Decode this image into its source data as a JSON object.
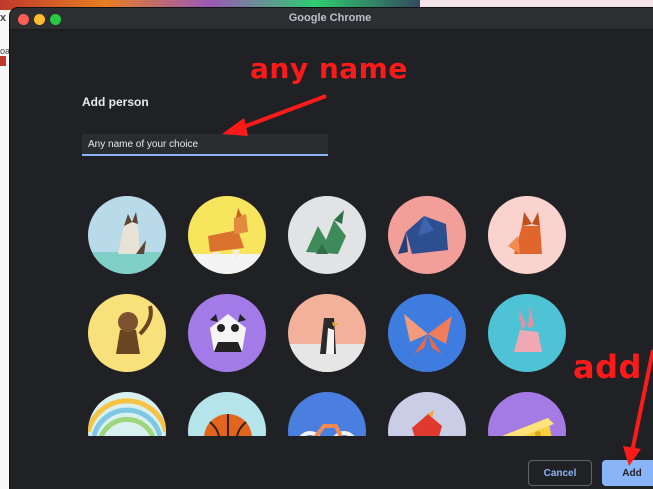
{
  "window": {
    "title": "Google Chrome"
  },
  "background": {
    "close_glyph": "x",
    "tab_fragment": "oa"
  },
  "dialog": {
    "heading": "Add person",
    "name_input": {
      "value": "Any name of your choice"
    },
    "avatars": [
      {
        "name": "cat",
        "bg": "#b9dbe9"
      },
      {
        "name": "corgi",
        "bg": "#f8e55e"
      },
      {
        "name": "dragon",
        "bg": "#e2e3e5"
      },
      {
        "name": "elephant",
        "bg": "#f29f9a"
      },
      {
        "name": "fox",
        "bg": "#fad3cf"
      },
      {
        "name": "monkey",
        "bg": "#f8e07a"
      },
      {
        "name": "panda",
        "bg": "#a37be8"
      },
      {
        "name": "penguin",
        "bg": "#f3b19b"
      },
      {
        "name": "butterfly",
        "bg": "#3f7ce0"
      },
      {
        "name": "rabbit",
        "bg": "#4fc3d6"
      },
      {
        "name": "unicorn",
        "bg": "#d8f0ef"
      },
      {
        "name": "basketball",
        "bg": "#b5e5ea"
      },
      {
        "name": "bicycle",
        "bg": "#4a7fe0"
      },
      {
        "name": "bird",
        "bg": "#c9cde6"
      },
      {
        "name": "cheese",
        "bg": "#a47be5"
      }
    ],
    "cancel_label": "Cancel",
    "add_label": "Add"
  },
  "annotations": {
    "name_label": "any name",
    "add_label": "add",
    "color": "#ff1a1a"
  },
  "colors": {
    "accent": "#8ab4f8",
    "dialog_bg": "#202124"
  }
}
